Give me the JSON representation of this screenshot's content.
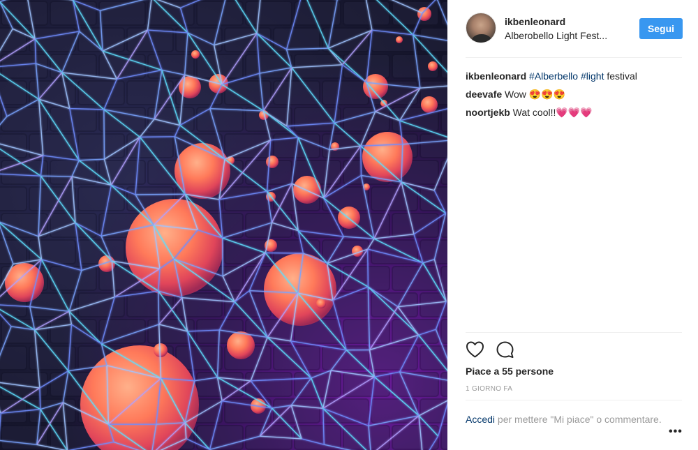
{
  "post": {
    "username": "ikbenleonard",
    "location": "Alberobello Light Fest...",
    "follow_label": "Segui"
  },
  "comments": [
    {
      "author": "ikbenleonard",
      "parts": [
        {
          "text": "#Alberbello",
          "type": "hashtag"
        },
        {
          "text": " ",
          "type": "text"
        },
        {
          "text": "#light",
          "type": "hashtag"
        },
        {
          "text": " festival",
          "type": "text"
        }
      ]
    },
    {
      "author": "deevafe",
      "text": "Wow 😍😍😍"
    },
    {
      "author": "noortjekb",
      "text": "Wat cool!!💗💗💗"
    }
  ],
  "likes_text": "Piace a 55 persone",
  "timestamp": "1 GIORNO FA",
  "login": {
    "link": "Accedi",
    "rest": " per mettere \"Mi piace\" o commentare."
  },
  "icons": {
    "like": "heart-icon",
    "comment": "comment-icon",
    "more": "more-options-icon"
  },
  "colors": {
    "follow_button": "#3897f0",
    "hashtag": "#003569",
    "muted": "#999999"
  }
}
